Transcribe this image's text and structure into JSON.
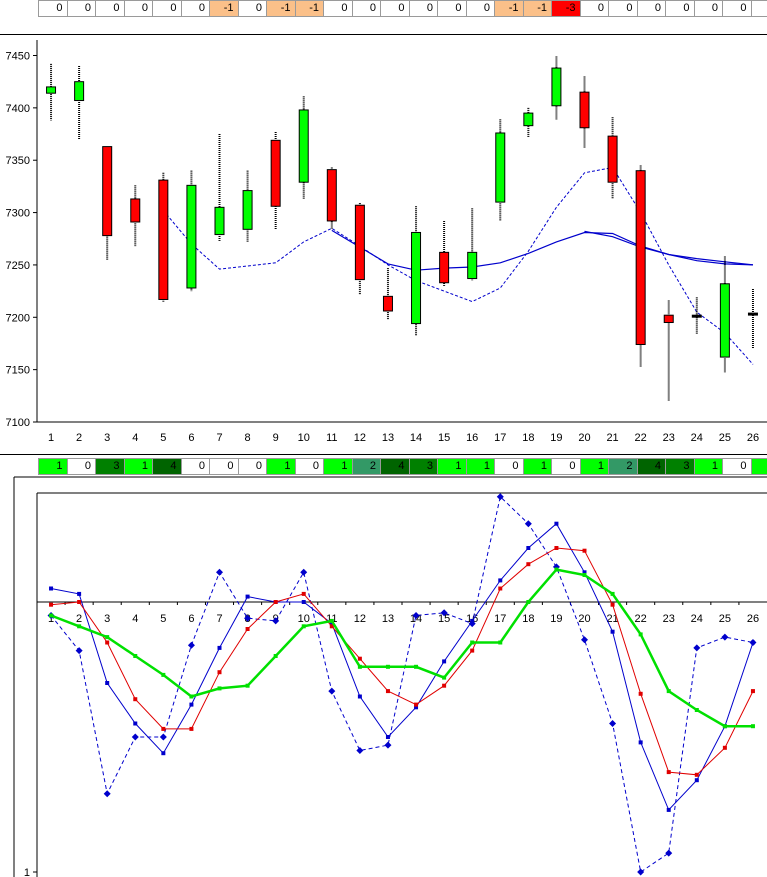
{
  "colors": {
    "up_candle": "#00ff00",
    "down_candle": "#ff0000",
    "ma_blue": "#0000cc",
    "osc_red": "#e00000",
    "osc_green": "#00e000",
    "cell_zero": "#ffffff",
    "cell_minus1": "#fbc089",
    "cell_minus3": "#ff0000",
    "cell_1": "#00ff00",
    "cell_2": "#339966",
    "cell_3": "#008000",
    "cell_4": "#006400"
  },
  "top_strip": {
    "values": [
      "0",
      "0",
      "0",
      "0",
      "0",
      "0",
      "-1",
      "0",
      "-1",
      "-1",
      "0",
      "0",
      "0",
      "0",
      "0",
      "0",
      "-1",
      "-1",
      "-3",
      "0",
      "0",
      "0",
      "0",
      "0",
      "0",
      "0"
    ],
    "fills": [
      "zero",
      "zero",
      "zero",
      "zero",
      "zero",
      "zero",
      "minus1",
      "zero",
      "minus1",
      "minus1",
      "zero",
      "zero",
      "zero",
      "zero",
      "zero",
      "zero",
      "minus1",
      "minus1",
      "minus3",
      "zero",
      "zero",
      "zero",
      "zero",
      "zero",
      "zero",
      "zero"
    ]
  },
  "mid_strip": {
    "values": [
      "1",
      "0",
      "3",
      "1",
      "4",
      "0",
      "0",
      "0",
      "1",
      "0",
      "1",
      "2",
      "4",
      "3",
      "1",
      "1",
      "0",
      "1",
      "0",
      "1",
      "2",
      "4",
      "3",
      "1",
      "0",
      "1"
    ],
    "fills": [
      "1",
      "zero",
      "3",
      "1",
      "4",
      "zero",
      "zero",
      "zero",
      "1",
      "zero",
      "1",
      "2",
      "4",
      "3",
      "1",
      "1",
      "zero",
      "1",
      "zero",
      "1",
      "2",
      "4",
      "3",
      "1",
      "zero",
      "1"
    ]
  },
  "chart_data": [
    {
      "type": "candlestick",
      "categories": [
        "1",
        "2",
        "3",
        "4",
        "5",
        "6",
        "7",
        "8",
        "9",
        "10",
        "11",
        "12",
        "13",
        "14",
        "15",
        "16",
        "17",
        "18",
        "19",
        "20",
        "21",
        "22",
        "23",
        "24",
        "25",
        "26"
      ],
      "y_ticks": [
        "7100",
        "7150",
        "7200",
        "7250",
        "7300",
        "7350",
        "7400",
        "7450"
      ],
      "ylim": [
        7100,
        7460
      ],
      "candles": [
        {
          "o": 7414,
          "c": 7420,
          "h": 7442,
          "l": 7388
        },
        {
          "o": 7407,
          "c": 7425,
          "h": 7440,
          "l": 7370
        },
        {
          "o": 7363,
          "c": 7278,
          "h": 7363,
          "l": 7255
        },
        {
          "o": 7313,
          "c": 7291,
          "h": 7326,
          "l": 7268
        },
        {
          "o": 7331,
          "c": 7217,
          "h": 7338,
          "l": 7215
        },
        {
          "o": 7228,
          "c": 7326,
          "h": 7340,
          "l": 7225
        },
        {
          "o": 7279,
          "c": 7305,
          "h": 7375,
          "l": 7273
        },
        {
          "o": 7284,
          "c": 7321,
          "h": 7340,
          "l": 7272
        },
        {
          "o": 7369,
          "c": 7306,
          "h": 7377,
          "l": 7284
        },
        {
          "o": 7329,
          "c": 7398,
          "h": 7411,
          "l": 7313
        },
        {
          "o": 7341,
          "c": 7292,
          "h": 7343,
          "l": 7284
        },
        {
          "o": 7307,
          "c": 7236,
          "h": 7309,
          "l": 7222
        },
        {
          "o": 7220,
          "c": 7206,
          "h": 7247,
          "l": 7198
        },
        {
          "o": 7194,
          "c": 7281,
          "h": 7306,
          "l": 7182
        },
        {
          "o": 7262,
          "c": 7233,
          "h": 7292,
          "l": 7230
        },
        {
          "o": 7237,
          "c": 7262,
          "h": 7304,
          "l": 7235
        },
        {
          "o": 7310,
          "c": 7376,
          "h": 7389,
          "l": 7292
        },
        {
          "o": 7383,
          "c": 7395,
          "h": 7400,
          "l": 7372
        },
        {
          "o": 7402,
          "c": 7438,
          "h": 7449,
          "l": 7389
        },
        {
          "o": 7415,
          "c": 7381,
          "h": 7430,
          "l": 7362
        },
        {
          "o": 7373,
          "c": 7329,
          "h": 7391,
          "l": 7313
        },
        {
          "o": 7340,
          "c": 7174,
          "h": 7345,
          "l": 7153
        },
        {
          "o": 7202,
          "c": 7195,
          "h": 7216,
          "l": 7120
        },
        {
          "o": 7202,
          "c": 7202,
          "h": 7219,
          "l": 7184
        },
        {
          "o": 7162,
          "c": 7232,
          "h": 7258,
          "l": 7147
        },
        {
          "o": 7204,
          "c": 7204,
          "h": 7227,
          "l": 7170
        }
      ],
      "ma_dashed": [
        null,
        null,
        null,
        null,
        7302,
        7270,
        7246,
        7249,
        7252,
        7272,
        7285,
        7268,
        7250,
        7235,
        7225,
        7215,
        7228,
        7263,
        7305,
        7338,
        7343,
        7300,
        7250,
        7205,
        7185,
        7155
      ],
      "ma_solid": [
        null,
        null,
        null,
        null,
        null,
        null,
        null,
        null,
        null,
        null,
        7283,
        7267,
        7251,
        7245,
        7247,
        7248,
        7252,
        7261,
        7272,
        7281,
        7280,
        7268,
        7260,
        7256,
        7253,
        7250
      ],
      "ma_solid2": [
        null,
        null,
        null,
        null,
        null,
        null,
        null,
        null,
        null,
        null,
        null,
        null,
        null,
        null,
        null,
        null,
        null,
        null,
        null,
        7282,
        7277,
        7267,
        7260,
        7254,
        7251,
        7250
      ]
    },
    {
      "type": "line",
      "categories": [
        "1",
        "2",
        "3",
        "4",
        "5",
        "6",
        "7",
        "8",
        "9",
        "10",
        "11",
        "12",
        "13",
        "14",
        "15",
        "16",
        "17",
        "18",
        "19",
        "20",
        "21",
        "22",
        "23",
        "24",
        "25",
        "26"
      ],
      "y_ticks": [
        "1"
      ],
      "ylim": [
        -1,
        0.4
      ],
      "series": [
        {
          "style": "dashed-diamond",
          "color": "#0000cc",
          "values": [
            -0.05,
            -0.18,
            -0.71,
            -0.5,
            -0.5,
            -0.16,
            0.11,
            -0.06,
            -0.07,
            0.11,
            -0.33,
            -0.55,
            -0.53,
            -0.05,
            -0.04,
            -0.08,
            0.39,
            0.29,
            0.13,
            -0.14,
            -0.45,
            -1.0,
            -0.93,
            -0.17,
            -0.13,
            -0.15
          ],
          "marker": "diamond"
        },
        {
          "style": "solid-square",
          "color": "#0000cc",
          "values": [
            0.05,
            0.03,
            -0.3,
            -0.45,
            -0.56,
            -0.38,
            -0.17,
            0.02,
            0.0,
            0.0,
            -0.08,
            -0.35,
            -0.5,
            -0.39,
            -0.22,
            -0.07,
            0.08,
            0.2,
            0.29,
            0.11,
            -0.11,
            -0.52,
            -0.77,
            -0.66,
            -0.46,
            -0.15
          ],
          "marker": "square"
        },
        {
          "style": "solid-square",
          "color": "#e00000",
          "values": [
            -0.01,
            0.0,
            -0.15,
            -0.36,
            -0.47,
            -0.47,
            -0.26,
            -0.1,
            0.0,
            0.03,
            -0.09,
            -0.21,
            -0.33,
            -0.38,
            -0.31,
            -0.18,
            0.05,
            0.14,
            0.2,
            0.19,
            -0.01,
            -0.34,
            -0.63,
            -0.64,
            -0.54,
            -0.33
          ],
          "marker": "square"
        },
        {
          "style": "thick",
          "color": "#00e000",
          "values": [
            -0.05,
            -0.09,
            -0.13,
            -0.2,
            -0.27,
            -0.35,
            -0.32,
            -0.31,
            -0.2,
            -0.09,
            -0.07,
            -0.24,
            -0.24,
            -0.24,
            -0.28,
            -0.15,
            -0.15,
            0.0,
            0.12,
            0.1,
            0.03,
            -0.12,
            -0.33,
            -0.4,
            -0.46,
            -0.46
          ],
          "marker": "square"
        }
      ]
    }
  ]
}
